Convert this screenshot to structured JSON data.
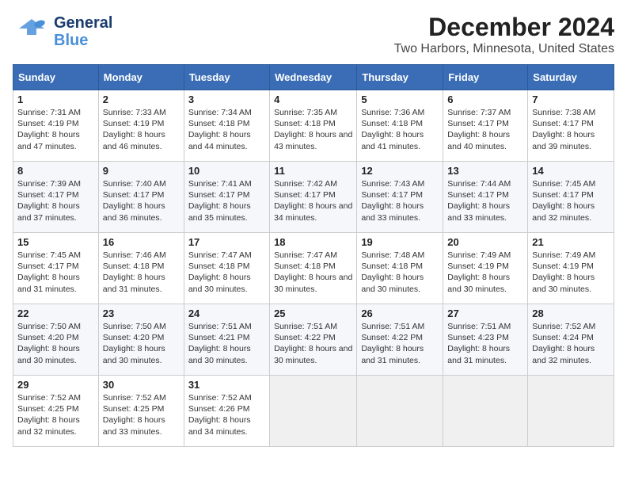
{
  "header": {
    "logo_line1": "General",
    "logo_line2": "Blue",
    "title": "December 2024",
    "subtitle": "Two Harbors, Minnesota, United States"
  },
  "columns": [
    "Sunday",
    "Monday",
    "Tuesday",
    "Wednesday",
    "Thursday",
    "Friday",
    "Saturday"
  ],
  "weeks": [
    [
      {
        "day": "1",
        "sunrise": "Sunrise: 7:31 AM",
        "sunset": "Sunset: 4:19 PM",
        "daylight": "Daylight: 8 hours and 47 minutes."
      },
      {
        "day": "2",
        "sunrise": "Sunrise: 7:33 AM",
        "sunset": "Sunset: 4:19 PM",
        "daylight": "Daylight: 8 hours and 46 minutes."
      },
      {
        "day": "3",
        "sunrise": "Sunrise: 7:34 AM",
        "sunset": "Sunset: 4:18 PM",
        "daylight": "Daylight: 8 hours and 44 minutes."
      },
      {
        "day": "4",
        "sunrise": "Sunrise: 7:35 AM",
        "sunset": "Sunset: 4:18 PM",
        "daylight": "Daylight: 8 hours and 43 minutes."
      },
      {
        "day": "5",
        "sunrise": "Sunrise: 7:36 AM",
        "sunset": "Sunset: 4:18 PM",
        "daylight": "Daylight: 8 hours and 41 minutes."
      },
      {
        "day": "6",
        "sunrise": "Sunrise: 7:37 AM",
        "sunset": "Sunset: 4:17 PM",
        "daylight": "Daylight: 8 hours and 40 minutes."
      },
      {
        "day": "7",
        "sunrise": "Sunrise: 7:38 AM",
        "sunset": "Sunset: 4:17 PM",
        "daylight": "Daylight: 8 hours and 39 minutes."
      }
    ],
    [
      {
        "day": "8",
        "sunrise": "Sunrise: 7:39 AM",
        "sunset": "Sunset: 4:17 PM",
        "daylight": "Daylight: 8 hours and 37 minutes."
      },
      {
        "day": "9",
        "sunrise": "Sunrise: 7:40 AM",
        "sunset": "Sunset: 4:17 PM",
        "daylight": "Daylight: 8 hours and 36 minutes."
      },
      {
        "day": "10",
        "sunrise": "Sunrise: 7:41 AM",
        "sunset": "Sunset: 4:17 PM",
        "daylight": "Daylight: 8 hours and 35 minutes."
      },
      {
        "day": "11",
        "sunrise": "Sunrise: 7:42 AM",
        "sunset": "Sunset: 4:17 PM",
        "daylight": "Daylight: 8 hours and 34 minutes."
      },
      {
        "day": "12",
        "sunrise": "Sunrise: 7:43 AM",
        "sunset": "Sunset: 4:17 PM",
        "daylight": "Daylight: 8 hours and 33 minutes."
      },
      {
        "day": "13",
        "sunrise": "Sunrise: 7:44 AM",
        "sunset": "Sunset: 4:17 PM",
        "daylight": "Daylight: 8 hours and 33 minutes."
      },
      {
        "day": "14",
        "sunrise": "Sunrise: 7:45 AM",
        "sunset": "Sunset: 4:17 PM",
        "daylight": "Daylight: 8 hours and 32 minutes."
      }
    ],
    [
      {
        "day": "15",
        "sunrise": "Sunrise: 7:45 AM",
        "sunset": "Sunset: 4:17 PM",
        "daylight": "Daylight: 8 hours and 31 minutes."
      },
      {
        "day": "16",
        "sunrise": "Sunrise: 7:46 AM",
        "sunset": "Sunset: 4:18 PM",
        "daylight": "Daylight: 8 hours and 31 minutes."
      },
      {
        "day": "17",
        "sunrise": "Sunrise: 7:47 AM",
        "sunset": "Sunset: 4:18 PM",
        "daylight": "Daylight: 8 hours and 30 minutes."
      },
      {
        "day": "18",
        "sunrise": "Sunrise: 7:47 AM",
        "sunset": "Sunset: 4:18 PM",
        "daylight": "Daylight: 8 hours and 30 minutes."
      },
      {
        "day": "19",
        "sunrise": "Sunrise: 7:48 AM",
        "sunset": "Sunset: 4:18 PM",
        "daylight": "Daylight: 8 hours and 30 minutes."
      },
      {
        "day": "20",
        "sunrise": "Sunrise: 7:49 AM",
        "sunset": "Sunset: 4:19 PM",
        "daylight": "Daylight: 8 hours and 30 minutes."
      },
      {
        "day": "21",
        "sunrise": "Sunrise: 7:49 AM",
        "sunset": "Sunset: 4:19 PM",
        "daylight": "Daylight: 8 hours and 30 minutes."
      }
    ],
    [
      {
        "day": "22",
        "sunrise": "Sunrise: 7:50 AM",
        "sunset": "Sunset: 4:20 PM",
        "daylight": "Daylight: 8 hours and 30 minutes."
      },
      {
        "day": "23",
        "sunrise": "Sunrise: 7:50 AM",
        "sunset": "Sunset: 4:20 PM",
        "daylight": "Daylight: 8 hours and 30 minutes."
      },
      {
        "day": "24",
        "sunrise": "Sunrise: 7:51 AM",
        "sunset": "Sunset: 4:21 PM",
        "daylight": "Daylight: 8 hours and 30 minutes."
      },
      {
        "day": "25",
        "sunrise": "Sunrise: 7:51 AM",
        "sunset": "Sunset: 4:22 PM",
        "daylight": "Daylight: 8 hours and 30 minutes."
      },
      {
        "day": "26",
        "sunrise": "Sunrise: 7:51 AM",
        "sunset": "Sunset: 4:22 PM",
        "daylight": "Daylight: 8 hours and 31 minutes."
      },
      {
        "day": "27",
        "sunrise": "Sunrise: 7:51 AM",
        "sunset": "Sunset: 4:23 PM",
        "daylight": "Daylight: 8 hours and 31 minutes."
      },
      {
        "day": "28",
        "sunrise": "Sunrise: 7:52 AM",
        "sunset": "Sunset: 4:24 PM",
        "daylight": "Daylight: 8 hours and 32 minutes."
      }
    ],
    [
      {
        "day": "29",
        "sunrise": "Sunrise: 7:52 AM",
        "sunset": "Sunset: 4:25 PM",
        "daylight": "Daylight: 8 hours and 32 minutes."
      },
      {
        "day": "30",
        "sunrise": "Sunrise: 7:52 AM",
        "sunset": "Sunset: 4:25 PM",
        "daylight": "Daylight: 8 hours and 33 minutes."
      },
      {
        "day": "31",
        "sunrise": "Sunrise: 7:52 AM",
        "sunset": "Sunset: 4:26 PM",
        "daylight": "Daylight: 8 hours and 34 minutes."
      },
      null,
      null,
      null,
      null
    ]
  ]
}
